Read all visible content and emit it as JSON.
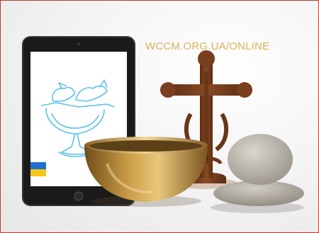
{
  "url_text": "WCCM.ORG.UA/ONLINE",
  "colors": {
    "border": "#c0392b",
    "url_text": "#d8b45c",
    "bird_logo": "#5bc0e8",
    "flag_blue": "#1f6fd1",
    "flag_yellow": "#f5c518",
    "bowl_gold": "#b8893a",
    "cross_wood": "#7a3f1e"
  },
  "icons": [
    "tablet",
    "bird-logo-icon",
    "ukraine-flag-icon",
    "singing-bowl",
    "carved-wooden-cross",
    "stacked-stones"
  ]
}
